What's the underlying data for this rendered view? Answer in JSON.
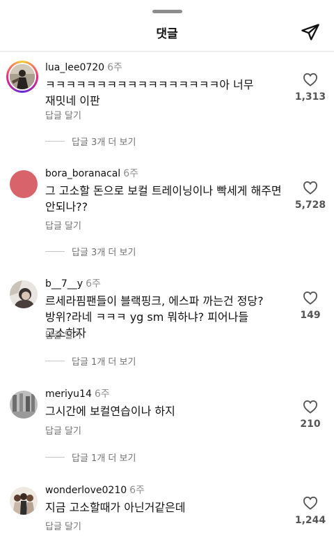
{
  "header": {
    "title": "댓글",
    "send_icon": "send-paper-plane-icon"
  },
  "comments": [
    {
      "username": "lua_lee0720",
      "time": "6주",
      "text": "ㅋㅋㅋㅋㅋㅋㅋㅋㅋㅋㅋㅋㅋㅋㅋㅋㅋ아 너무 재밋네 이판",
      "reply_label": "답글 달기",
      "more_replies": "답글 3개 더 보기",
      "likes": "1,313",
      "avatar_icon": "story-ring-avatar"
    },
    {
      "username": "bora_boranacal",
      "time": "6주",
      "text": "그 고소할 돈으로 보컬 트레이닝이나 빡세게 해주면 안되나??",
      "reply_label": "답글 달기",
      "more_replies": "답글 3개 더 보기",
      "likes": "5,728",
      "avatar_color": "#d9636b"
    },
    {
      "username": "b__7__y",
      "time": "6주",
      "text": "르세라핌팬들이 블랙핑크, 에스파 까는건 정당?방위?라네 ㅋㅋㅋ yg sm 뭐하냐? 피어나들 고소하자",
      "reply_label": "답글 달기",
      "more_replies": "답글 1개 더 보기",
      "likes": "149"
    },
    {
      "username": "meriyu14",
      "time": "6주",
      "text": "그시간에 보컬연습이나 하지",
      "reply_label": "답글 달기",
      "more_replies": "답글 1개 더 보기",
      "likes": "210"
    },
    {
      "username": "wonderlove0210",
      "time": "6주",
      "text": "지금 고소할때가 아닌거같은데",
      "reply_label": "답글 달기",
      "likes": "1,244"
    }
  ],
  "colors": {
    "secondary_text": "#8e8e8e",
    "divider": "#e6e6e6"
  }
}
